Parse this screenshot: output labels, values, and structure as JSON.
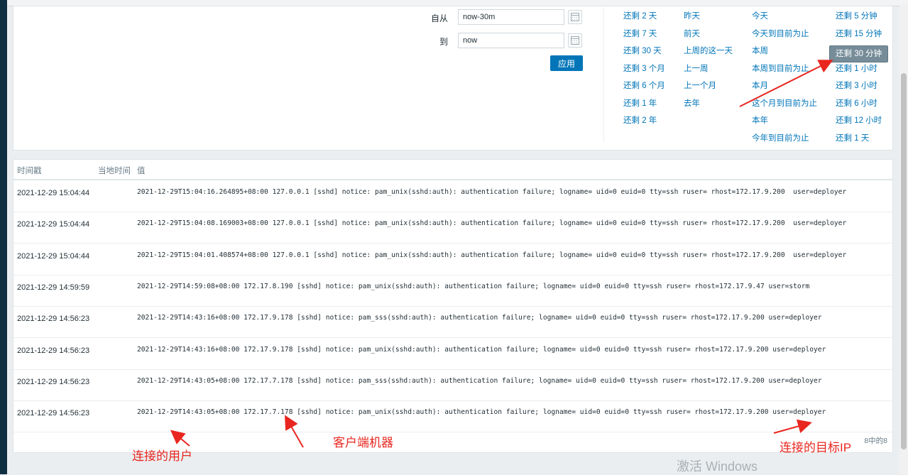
{
  "filter": {
    "from_label": "自从",
    "from_value": "now-30m",
    "to_label": "到",
    "to_value": "now",
    "apply_label": "应用"
  },
  "quick_ranges": {
    "col1": [
      "还剩 2 天",
      "还剩 7 天",
      "还剩 30 天",
      "还剩 3 个月",
      "还剩 6 个月",
      "还剩 1 年",
      "还剩 2 年"
    ],
    "col2": [
      "昨天",
      "前天",
      "上周的这一天",
      "上一周",
      "上一个月",
      "去年"
    ],
    "col3": [
      "今天",
      "今天到目前为止",
      "本周",
      "本周到目前为止",
      "本月",
      "这个月到目前为止",
      "本年",
      "今年到目前为止"
    ],
    "col4": [
      "还剩 5 分钟",
      "还剩 15 分钟",
      "还剩 30 分钟",
      "还剩 1 小时",
      "还剩 3 小时",
      "还剩 6 小时",
      "还剩 12 小时",
      "还剩 1 天"
    ],
    "selected": "还剩 30 分钟"
  },
  "table": {
    "headers": [
      "时间戳",
      "当地时间",
      "值"
    ],
    "rows": [
      {
        "ts": "2021-12-29 15:04:44",
        "value": "2021-12-29T15:04:16.264895+08:00 127.0.0.1 [sshd] notice: pam_unix(sshd:auth): authentication failure; logname= uid=0 euid=0 tty=ssh ruser= rhost=172.17.9.200  user=deployer"
      },
      {
        "ts": "2021-12-29 15:04:44",
        "value": "2021-12-29T15:04:08.169003+08:00 127.0.0.1 [sshd] notice: pam_unix(sshd:auth): authentication failure; logname= uid=0 euid=0 tty=ssh ruser= rhost=172.17.9.200  user=deployer"
      },
      {
        "ts": "2021-12-29 15:04:44",
        "value": "2021-12-29T15:04:01.408574+08:00 127.0.0.1 [sshd] notice: pam_unix(sshd:auth): authentication failure; logname= uid=0 euid=0 tty=ssh ruser= rhost=172.17.9.200  user=deployer"
      },
      {
        "ts": "2021-12-29 14:59:59",
        "value": "2021-12-29T14:59:08+08:00 172.17.8.190 [sshd] notice: pam_unix(sshd:auth): authentication failure; logname= uid=0 euid=0 tty=ssh ruser= rhost=172.17.9.47 user=storm"
      },
      {
        "ts": "2021-12-29 14:56:23",
        "value": "2021-12-29T14:43:16+08:00 172.17.9.178 [sshd] notice: pam_sss(sshd:auth): authentication failure; logname= uid=0 euid=0 tty=ssh ruser= rhost=172.17.9.200 user=deployer"
      },
      {
        "ts": "2021-12-29 14:56:23",
        "value": "2021-12-29T14:43:16+08:00 172.17.9.178 [sshd] notice: pam_unix(sshd:auth): authentication failure; logname= uid=0 euid=0 tty=ssh ruser= rhost=172.17.9.200 user=deployer"
      },
      {
        "ts": "2021-12-29 14:56:23",
        "value": "2021-12-29T14:43:05+08:00 172.17.7.178 [sshd] notice: pam_sss(sshd:auth): authentication failure; logname= uid=0 euid=0 tty=ssh ruser= rhost=172.17.9.200 user=deployer"
      },
      {
        "ts": "2021-12-29 14:56:23",
        "value": "2021-12-29T14:43:05+08:00 172.17.7.178 [sshd] notice: pam_unix(sshd:auth): authentication failure; logname= uid=0 euid=0 tty=ssh ruser= rhost=172.17.9.200 user=deployer"
      }
    ],
    "footer": "8中的8"
  },
  "annotations": {
    "user": "连接的用户",
    "client": "客户端机器",
    "target": "连接的目标IP",
    "color": "#e8261f"
  },
  "watermark": "激活 Windows"
}
